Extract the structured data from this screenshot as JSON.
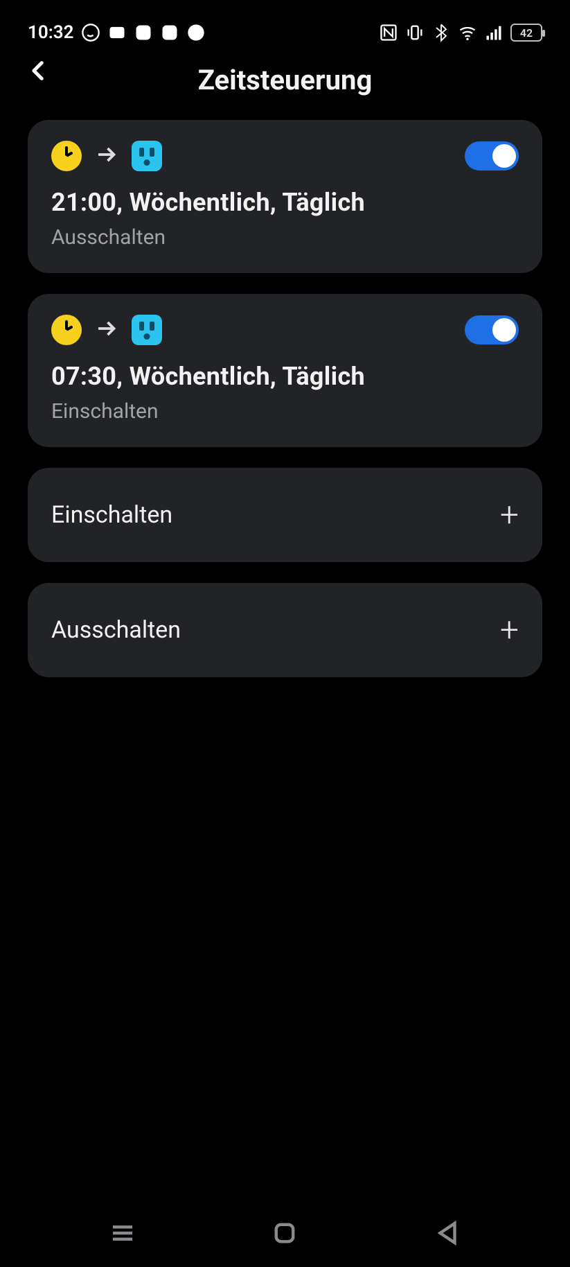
{
  "status_bar": {
    "time": "10:32",
    "battery_pct": "42"
  },
  "header": {
    "title": "Zeitsteuerung"
  },
  "schedules": [
    {
      "title": "21:00, Wöchentlich, Täglich",
      "action": "Ausschalten",
      "enabled": true
    },
    {
      "title": "07:30, Wöchentlich, Täglich",
      "action": "Einschalten",
      "enabled": true
    }
  ],
  "add_actions": [
    {
      "label": "Einschalten"
    },
    {
      "label": "Ausschalten"
    }
  ]
}
